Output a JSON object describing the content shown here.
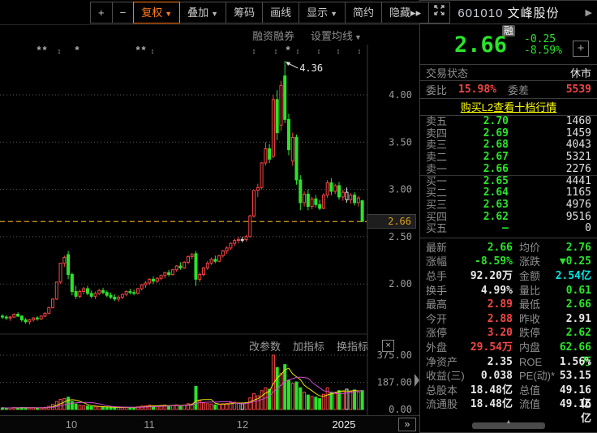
{
  "colors": {
    "up": "#f54545",
    "down": "#2ae42a",
    "cyan": "#00e5e5",
    "link_yellow": "#ffff00",
    "price_line_gold": "#d8a018",
    "accent_orange": "#ff7a1a",
    "ma5_yellow": "#e8e800",
    "ma10_magenta": "#d048d0"
  },
  "toolbar": {
    "buttons": [
      {
        "name": "zoom-in-button",
        "label": "+"
      },
      {
        "name": "zoom-out-button",
        "label": "−"
      },
      {
        "name": "fuquan-adjust-button",
        "label": "复权",
        "dropdown": true,
        "active": true
      },
      {
        "name": "overlay-button",
        "label": "叠加",
        "dropdown": true
      },
      {
        "name": "chip-distribution-button",
        "label": "筹码"
      },
      {
        "name": "draw-line-button",
        "label": "画线"
      },
      {
        "name": "display-button",
        "label": "显示",
        "dropdown": true
      },
      {
        "name": "simple-mode-button",
        "label": "简约"
      },
      {
        "name": "hide-button",
        "label": "隐藏▸▸"
      },
      {
        "name": "fullscreen-button",
        "label": "",
        "icon": "expand"
      }
    ]
  },
  "chart": {
    "links": {
      "margin_trading": "融资融券",
      "ma_setting": "设置均线"
    },
    "indicator_links": [
      "改参数",
      "加指标",
      "换指标"
    ],
    "indicator_close": "×",
    "y_ticks": [
      "4.00",
      "3.50",
      "3.00",
      "2.50",
      "2.00"
    ],
    "vol_ticks": [
      "375.00",
      "187.00",
      "0.00"
    ],
    "price_line_value": 2.66,
    "price_line_label": "2.66",
    "peak_annotation": "4.36",
    "x_labels": [
      {
        "label": "10",
        "x": 88
      },
      {
        "label": "11",
        "x": 184
      },
      {
        "label": "12",
        "x": 299
      },
      {
        "label": "2025",
        "x": 424,
        "highlight": true
      }
    ],
    "forward_button": "»",
    "markers": [
      {
        "x": 48,
        "g": "*"
      },
      {
        "x": 55,
        "g": "*"
      },
      {
        "x": 73,
        "g": "↕"
      },
      {
        "x": 95,
        "g": "*"
      },
      {
        "x": 170,
        "g": "*"
      },
      {
        "x": 177,
        "g": "*"
      },
      {
        "x": 188,
        "g": "↕"
      },
      {
        "x": 313,
        "g": "↕"
      },
      {
        "x": 340,
        "g": "↕"
      },
      {
        "x": 355,
        "g": "*"
      },
      {
        "x": 367,
        "g": "↕"
      },
      {
        "x": 393,
        "g": "↕"
      },
      {
        "x": 417,
        "g": "↕"
      },
      {
        "x": 443,
        "g": "↕"
      }
    ],
    "candles": [
      [
        1.66,
        1.68,
        1.63,
        1.65,
        12
      ],
      [
        1.65,
        1.67,
        1.62,
        1.64,
        10
      ],
      [
        1.64,
        1.66,
        1.61,
        1.65,
        11
      ],
      [
        1.65,
        1.69,
        1.64,
        1.68,
        13
      ],
      [
        1.68,
        1.7,
        1.65,
        1.66,
        12
      ],
      [
        1.66,
        1.67,
        1.6,
        1.62,
        14
      ],
      [
        1.62,
        1.64,
        1.58,
        1.6,
        13
      ],
      [
        1.6,
        1.63,
        1.57,
        1.62,
        11
      ],
      [
        1.62,
        1.65,
        1.6,
        1.64,
        12
      ],
      [
        1.64,
        1.66,
        1.61,
        1.63,
        10
      ],
      [
        1.63,
        1.67,
        1.62,
        1.66,
        12
      ],
      [
        1.66,
        1.7,
        1.65,
        1.69,
        15
      ],
      [
        1.69,
        1.76,
        1.68,
        1.75,
        22
      ],
      [
        1.75,
        1.85,
        1.74,
        1.84,
        35
      ],
      [
        1.84,
        2.02,
        1.83,
        2.02,
        55
      ],
      [
        2.02,
        2.22,
        2.0,
        2.22,
        70
      ],
      [
        2.22,
        2.3,
        2.18,
        2.28,
        75
      ],
      [
        2.31,
        2.35,
        2.05,
        2.1,
        85
      ],
      [
        2.1,
        2.12,
        1.88,
        1.92,
        55
      ],
      [
        1.92,
        1.98,
        1.84,
        1.87,
        38
      ],
      [
        1.87,
        1.94,
        1.85,
        1.92,
        30
      ],
      [
        1.92,
        1.97,
        1.89,
        1.95,
        26
      ],
      [
        1.95,
        1.98,
        1.88,
        1.9,
        24
      ],
      [
        1.9,
        1.93,
        1.85,
        1.87,
        20
      ],
      [
        1.87,
        1.92,
        1.84,
        1.9,
        18
      ],
      [
        1.9,
        1.95,
        1.88,
        1.93,
        19
      ],
      [
        1.93,
        1.96,
        1.89,
        1.91,
        17
      ],
      [
        1.91,
        1.93,
        1.86,
        1.88,
        15
      ],
      [
        1.88,
        1.91,
        1.84,
        1.86,
        14
      ],
      [
        1.86,
        1.89,
        1.82,
        1.84,
        13
      ],
      [
        1.84,
        1.88,
        1.81,
        1.86,
        14
      ],
      [
        1.86,
        1.9,
        1.84,
        1.89,
        15
      ],
      [
        1.89,
        1.93,
        1.87,
        1.92,
        16
      ],
      [
        1.92,
        1.95,
        1.89,
        1.91,
        14
      ],
      [
        1.91,
        1.94,
        1.88,
        1.9,
        13
      ],
      [
        1.9,
        1.96,
        1.89,
        1.95,
        18
      ],
      [
        1.95,
        2.0,
        1.93,
        1.99,
        24
      ],
      [
        1.99,
        2.03,
        1.96,
        2.01,
        26
      ],
      [
        2.01,
        2.06,
        1.99,
        2.05,
        30
      ],
      [
        2.05,
        2.08,
        2.0,
        2.03,
        25
      ],
      [
        2.03,
        2.07,
        2.01,
        2.06,
        24
      ],
      [
        2.06,
        2.1,
        2.04,
        2.09,
        28
      ],
      [
        2.09,
        2.13,
        2.06,
        2.12,
        30
      ],
      [
        2.12,
        2.15,
        2.08,
        2.1,
        26
      ],
      [
        2.1,
        2.16,
        2.09,
        2.15,
        28
      ],
      [
        2.15,
        2.2,
        2.13,
        2.19,
        32
      ],
      [
        2.19,
        2.23,
        2.15,
        2.17,
        28
      ],
      [
        2.17,
        2.24,
        2.16,
        2.23,
        30
      ],
      [
        2.23,
        2.3,
        2.21,
        2.29,
        40
      ],
      [
        2.29,
        2.33,
        2.26,
        2.31,
        38
      ],
      [
        2.32,
        2.35,
        1.98,
        2.05,
        160
      ],
      [
        2.05,
        2.12,
        2.02,
        2.1,
        60
      ],
      [
        2.1,
        2.18,
        2.08,
        2.17,
        45
      ],
      [
        2.17,
        2.24,
        2.15,
        2.22,
        40
      ],
      [
        2.22,
        2.28,
        2.2,
        2.26,
        38
      ],
      [
        2.26,
        2.3,
        2.22,
        2.24,
        32
      ],
      [
        2.24,
        2.31,
        2.23,
        2.3,
        36
      ],
      [
        2.3,
        2.36,
        2.28,
        2.35,
        40
      ],
      [
        2.35,
        2.4,
        2.32,
        2.38,
        42
      ],
      [
        2.38,
        2.44,
        2.36,
        2.43,
        48
      ],
      [
        2.43,
        2.48,
        2.4,
        2.46,
        50
      ],
      [
        2.46,
        2.5,
        2.43,
        2.47,
        45
      ],
      [
        2.47,
        2.5,
        2.44,
        2.47,
        40,
        "w"
      ],
      [
        2.47,
        2.52,
        2.45,
        2.5,
        46
      ],
      [
        2.5,
        2.73,
        2.49,
        2.72,
        80
      ],
      [
        2.72,
        2.99,
        2.7,
        2.99,
        110
      ],
      [
        2.99,
        3.06,
        2.92,
        3.02,
        95
      ],
      [
        3.02,
        3.29,
        3.0,
        3.28,
        130
      ],
      [
        3.28,
        3.5,
        3.25,
        3.43,
        150
      ],
      [
        3.43,
        3.48,
        3.28,
        3.32,
        140
      ],
      [
        3.35,
        4.0,
        3.33,
        3.95,
        375
      ],
      [
        3.95,
        4.05,
        3.52,
        3.6,
        290
      ],
      [
        3.68,
        4.15,
        3.62,
        4.1,
        250
      ],
      [
        4.2,
        4.36,
        3.7,
        3.74,
        310
      ],
      [
        3.74,
        3.8,
        3.36,
        3.42,
        200
      ],
      [
        3.3,
        3.6,
        3.25,
        3.55,
        180
      ],
      [
        3.55,
        3.58,
        3.05,
        3.1,
        190
      ],
      [
        3.1,
        3.15,
        2.78,
        2.86,
        150
      ],
      [
        2.86,
        2.98,
        2.82,
        2.95,
        120
      ],
      [
        2.95,
        3.0,
        2.78,
        2.82,
        100
      ],
      [
        2.82,
        2.92,
        2.79,
        2.9,
        90
      ],
      [
        2.9,
        2.94,
        2.81,
        2.84,
        85
      ],
      [
        2.84,
        2.89,
        2.78,
        2.8,
        75
      ],
      [
        2.8,
        2.96,
        2.79,
        2.94,
        105
      ],
      [
        2.94,
        3.1,
        2.91,
        3.07,
        150
      ],
      [
        3.07,
        3.12,
        2.94,
        2.98,
        120
      ],
      [
        2.98,
        3.06,
        2.95,
        3.04,
        120
      ],
      [
        3.04,
        3.08,
        2.89,
        2.92,
        130
      ],
      [
        2.92,
        3.0,
        2.88,
        2.97,
        125
      ],
      [
        2.97,
        3.02,
        2.86,
        2.89,
        140,
        "w"
      ],
      [
        2.89,
        2.96,
        2.85,
        2.94,
        125
      ],
      [
        2.94,
        2.97,
        2.83,
        2.86,
        135
      ],
      [
        2.86,
        2.93,
        2.82,
        2.91,
        120
      ],
      [
        2.88,
        2.89,
        2.66,
        2.66,
        130
      ]
    ]
  },
  "quote": {
    "nav_prev": "◀",
    "nav_next": "▶",
    "code": "601010",
    "name": "文峰股份",
    "margin_badge": "融",
    "last": "2.66",
    "change": "-0.25",
    "change_pct": "-8.59%",
    "add_button": "+",
    "status_label": "交易状态",
    "status_value": "休市",
    "weibi_label": "委比",
    "weibi_value": "15.98%",
    "weicha_label": "委差",
    "weicha_value": "5539",
    "l2_link": "购买L2查看十档行情",
    "orderbook": [
      {
        "side": "ask",
        "label": "卖五",
        "price": "2.70",
        "qty": "1460"
      },
      {
        "side": "ask",
        "label": "卖四",
        "price": "2.69",
        "qty": "1459"
      },
      {
        "side": "ask",
        "label": "卖三",
        "price": "2.68",
        "qty": "4043"
      },
      {
        "side": "ask",
        "label": "卖二",
        "price": "2.67",
        "qty": "5321"
      },
      {
        "side": "ask",
        "label": "卖一",
        "price": "2.66",
        "qty": "2276"
      },
      {
        "side": "bid",
        "label": "买一",
        "price": "2.65",
        "qty": "4441"
      },
      {
        "side": "bid",
        "label": "买二",
        "price": "2.64",
        "qty": "1165"
      },
      {
        "side": "bid",
        "label": "买三",
        "price": "2.63",
        "qty": "4976"
      },
      {
        "side": "bid",
        "label": "买四",
        "price": "2.62",
        "qty": "9516"
      },
      {
        "side": "bid",
        "label": "买五",
        "price": "—",
        "qty": "0"
      }
    ],
    "stats": [
      {
        "l": "最新",
        "v": "2.66",
        "c": "grn",
        "l2": "均价",
        "v2": "2.76",
        "c2": "grn"
      },
      {
        "l": "涨幅",
        "v": "-8.59%",
        "c": "grn",
        "l2": "涨跌",
        "v2": "▼0.25",
        "c2": "grn"
      },
      {
        "l": "总手",
        "v": "92.20万",
        "c": "wht",
        "l2": "金额",
        "v2": "2.54亿",
        "c2": "cyn"
      },
      {
        "l": "换手",
        "v": "4.99%",
        "c": "wht",
        "l2": "量比",
        "v2": "0.61",
        "c2": "grn"
      },
      {
        "l": "最高",
        "v": "2.89",
        "c": "red",
        "l2": "最低",
        "v2": "2.66",
        "c2": "grn"
      },
      {
        "l": "今开",
        "v": "2.88",
        "c": "red",
        "l2": "昨收",
        "v2": "2.91",
        "c2": "wht"
      },
      {
        "l": "涨停",
        "v": "3.20",
        "c": "red",
        "l2": "跌停",
        "v2": "2.62",
        "c2": "grn"
      },
      {
        "l": "外盘",
        "v": "29.54万",
        "c": "red",
        "l2": "内盘",
        "v2": "62.66万",
        "c2": "grn"
      },
      {
        "l": "净资产",
        "v": "2.35",
        "c": "wht",
        "l2": "ROE",
        "v2": "1.56%",
        "c2": "wht"
      },
      {
        "l": "收益(三)",
        "v": "0.038",
        "c": "wht",
        "l2": "PE(动)*",
        "v2": "53.15",
        "c2": "wht"
      },
      {
        "l": "总股本",
        "v": "18.48亿",
        "c": "wht",
        "l2": "总值",
        "v2": "49.16亿",
        "c2": "wht"
      },
      {
        "l": "流通股",
        "v": "18.48亿",
        "c": "wht",
        "l2": "流值",
        "v2": "49.16亿",
        "c2": "wht"
      }
    ]
  }
}
